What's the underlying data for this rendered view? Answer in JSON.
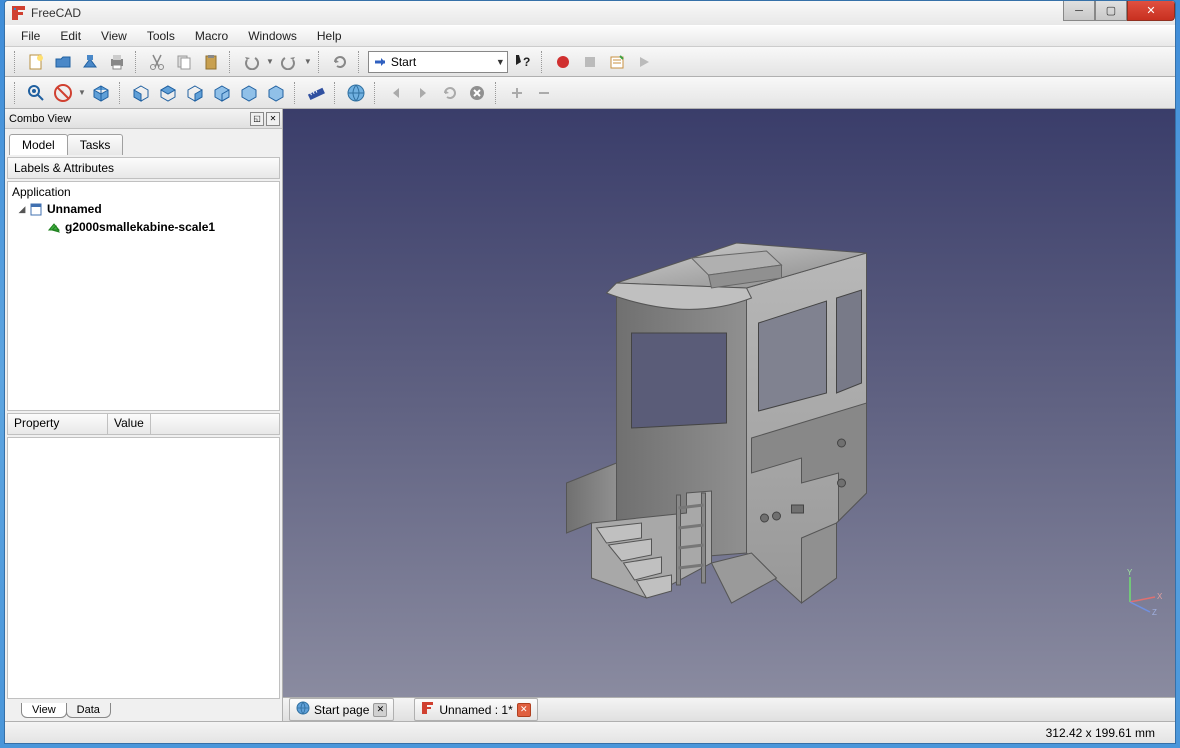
{
  "app": {
    "title": "FreeCAD"
  },
  "menu": [
    "File",
    "Edit",
    "View",
    "Tools",
    "Macro",
    "Windows",
    "Help"
  ],
  "workbench": {
    "selected": "Start"
  },
  "combo": {
    "title": "Combo View",
    "tabs": [
      "Model",
      "Tasks"
    ],
    "labels_header": "Labels & Attributes",
    "root": "Application",
    "doc": "Unnamed",
    "object": "g2000smallekabine-scale1"
  },
  "props": {
    "col1": "Property",
    "col2": "Value"
  },
  "bottom_tabs": [
    "View",
    "Data"
  ],
  "doc_tabs": [
    {
      "icon": "globe",
      "label": "Start page"
    },
    {
      "icon": "freecad",
      "label": "Unnamed : 1*"
    }
  ],
  "status": {
    "dims": "312.42 x 199.61  mm"
  }
}
